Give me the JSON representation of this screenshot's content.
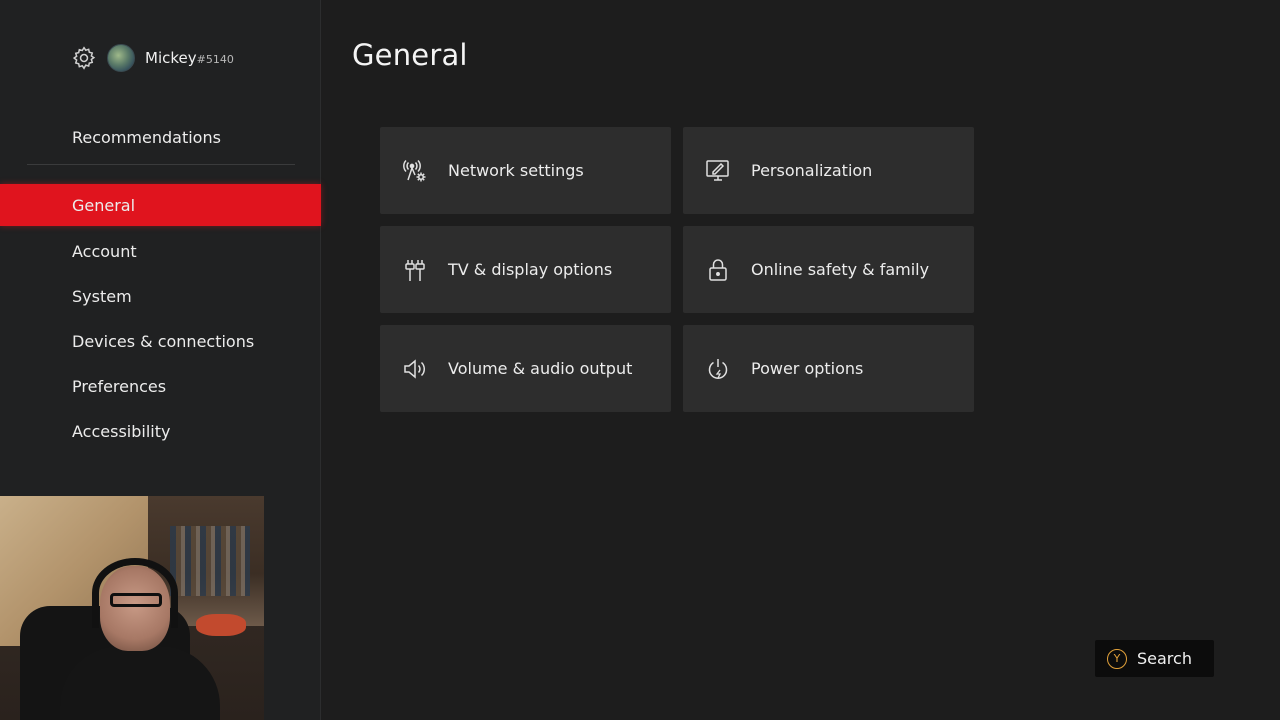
{
  "profile": {
    "gamertag": "Mickey",
    "gamertag_suffix": "#5140",
    "icons": [
      "gear-icon",
      "avatar"
    ]
  },
  "sidebar": {
    "recommendations_label": "Recommendations",
    "items": [
      {
        "label": "General",
        "active": true
      },
      {
        "label": "Account",
        "active": false
      },
      {
        "label": "System",
        "active": false
      },
      {
        "label": "Devices & connections",
        "active": false
      },
      {
        "label": "Preferences",
        "active": false
      },
      {
        "label": "Accessibility",
        "active": false
      }
    ]
  },
  "main": {
    "title": "General",
    "tiles": [
      {
        "label": "Network settings",
        "icon": "network-icon"
      },
      {
        "label": "Personalization",
        "icon": "personalization-icon"
      },
      {
        "label": "TV & display options",
        "icon": "tv-display-icon"
      },
      {
        "label": "Online safety & family",
        "icon": "lock-icon"
      },
      {
        "label": "Volume & audio output",
        "icon": "speaker-icon"
      },
      {
        "label": "Power options",
        "icon": "power-icon"
      }
    ]
  },
  "search_button": {
    "badge": "Y",
    "label": "Search"
  },
  "colors": {
    "accent": "#e0141e",
    "background": "#1d1d1d",
    "sidebar": "#202122",
    "tile": "#2d2d2d",
    "y_badge": "#e2a13a"
  }
}
